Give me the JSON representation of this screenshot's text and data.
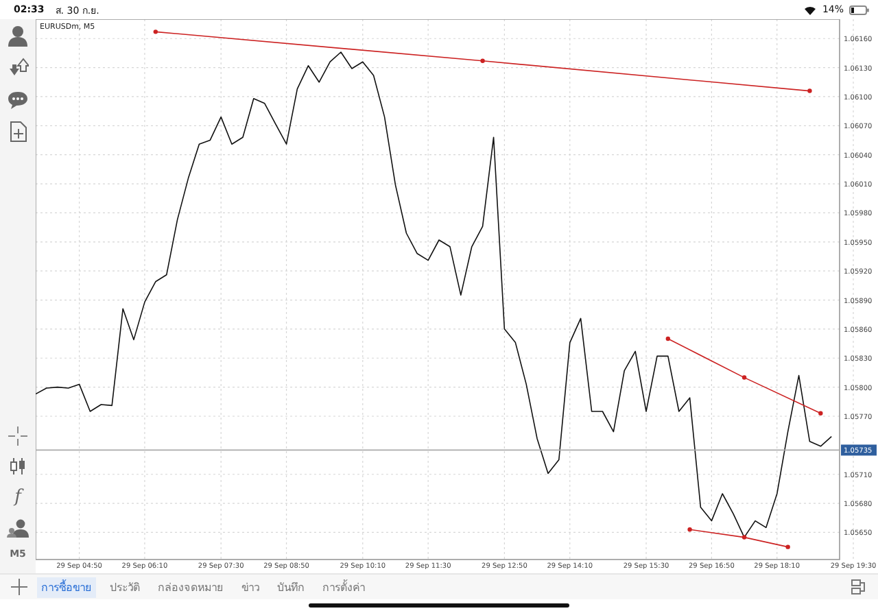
{
  "status_bar": {
    "time": "02:33",
    "date": "ส. 30 ก.ย.",
    "battery": "14%"
  },
  "toolbar": {
    "indicator": "f",
    "timeframe": "M5"
  },
  "chart": {
    "chart_data": {
      "type": "line",
      "title": "EURUSDm, M5",
      "categories": [
        null,
        null,
        null,
        null,
        "29 Sep 04:50",
        null,
        null,
        null,
        null,
        null,
        "29 Sep 06:10",
        null,
        null,
        null,
        null,
        null,
        null,
        "29 Sep 07:30",
        null,
        null,
        null,
        null,
        null,
        "29 Sep 08:50",
        null,
        null,
        null,
        null,
        null,
        null,
        "29 Sep 10:10",
        null,
        null,
        null,
        null,
        null,
        "29 Sep 11:30",
        null,
        null,
        null,
        null,
        null,
        null,
        "29 Sep 12:50",
        null,
        null,
        null,
        null,
        null,
        "29 Sep 14:10",
        null,
        null,
        null,
        null,
        null,
        null,
        "29 Sep 15:30",
        null,
        null,
        null,
        null,
        null,
        "29 Sep 16:50",
        null,
        null,
        null,
        null,
        null,
        "29 Sep 18:10",
        null,
        null,
        null,
        null,
        null,
        null,
        "29 Sep 19:30"
      ],
      "series": [
        {
          "color": "#111111",
          "values": [
            1.05793,
            1.05799,
            1.058,
            1.05799,
            1.05803,
            1.05775,
            1.05782,
            1.05781,
            1.05881,
            1.05849,
            1.05888,
            1.05909,
            1.05916,
            1.05973,
            1.06016,
            1.06051,
            1.06055,
            1.06079,
            1.06051,
            1.06058,
            1.06098,
            1.06093,
            1.06072,
            1.06051,
            1.06108,
            1.06132,
            1.06115,
            1.06136,
            1.06146,
            1.06129,
            1.06136,
            1.06122,
            1.06079,
            1.06009,
            1.05959,
            1.05938,
            1.05931,
            1.05952,
            1.05945,
            1.05895,
            1.05945,
            1.05966,
            1.06058,
            1.0586,
            1.05846,
            1.05803,
            1.05747,
            1.05711,
            1.05725,
            1.05846,
            1.05871,
            1.05775,
            1.05775,
            1.05754,
            1.05817,
            1.05837,
            1.05775,
            1.05832,
            1.05832,
            1.05775,
            1.05789,
            1.05676,
            1.05662,
            1.0569,
            1.05669,
            1.05645,
            1.05662,
            1.05655,
            1.0569,
            1.05754,
            1.05812,
            1.05744,
            1.05739,
            1.05749,
            null,
            null
          ]
        },
        {
          "color": "#cc2222",
          "marker": true,
          "values": [
            null,
            null,
            null,
            null,
            null,
            null,
            null,
            null,
            null,
            null,
            null,
            1.06167,
            null,
            null,
            null,
            null,
            null,
            null,
            null,
            null,
            null,
            null,
            null,
            null,
            null,
            null,
            null,
            null,
            null,
            null,
            null,
            null,
            null,
            null,
            null,
            null,
            null,
            null,
            null,
            null,
            null,
            1.06137,
            null,
            null,
            null,
            null,
            null,
            null,
            null,
            null,
            null,
            null,
            null,
            null,
            null,
            null,
            null,
            null,
            null,
            null,
            null,
            null,
            null,
            null,
            null,
            null,
            null,
            null,
            null,
            null,
            null,
            1.06106,
            null,
            null,
            null,
            null
          ]
        },
        {
          "color": "#cc2222",
          "marker": true,
          "values": [
            null,
            null,
            null,
            null,
            null,
            null,
            null,
            null,
            null,
            null,
            null,
            null,
            null,
            null,
            null,
            null,
            null,
            null,
            null,
            null,
            null,
            null,
            null,
            null,
            null,
            null,
            null,
            null,
            null,
            null,
            null,
            null,
            null,
            null,
            null,
            null,
            null,
            null,
            null,
            null,
            null,
            null,
            null,
            null,
            null,
            null,
            null,
            null,
            null,
            null,
            null,
            null,
            null,
            null,
            null,
            null,
            null,
            null,
            1.0585,
            null,
            null,
            null,
            null,
            null,
            null,
            1.0581,
            null,
            null,
            null,
            null,
            null,
            null,
            1.05773,
            null,
            null,
            null
          ]
        },
        {
          "color": "#cc2222",
          "marker": true,
          "values": [
            null,
            null,
            null,
            null,
            null,
            null,
            null,
            null,
            null,
            null,
            null,
            null,
            null,
            null,
            null,
            null,
            null,
            null,
            null,
            null,
            null,
            null,
            null,
            null,
            null,
            null,
            null,
            null,
            null,
            null,
            null,
            null,
            null,
            null,
            null,
            null,
            null,
            null,
            null,
            null,
            null,
            null,
            null,
            null,
            null,
            null,
            null,
            null,
            null,
            null,
            null,
            null,
            null,
            null,
            null,
            null,
            null,
            null,
            null,
            null,
            1.05653,
            null,
            null,
            null,
            null,
            1.05645,
            null,
            null,
            null,
            1.05635,
            null,
            null,
            null,
            null,
            null,
            null
          ]
        }
      ],
      "grid": true,
      "ylim": [
        1.05622,
        1.0618
      ],
      "yticks": [
        {
          "value": 1.0565,
          "label": "1.05650"
        },
        {
          "value": 1.0568,
          "label": "1.05680"
        },
        {
          "value": 1.0571,
          "label": "1.05710"
        },
        {
          "value": 1.0577,
          "label": "1.05770"
        },
        {
          "value": 1.058,
          "label": "1.05800"
        },
        {
          "value": 1.0583,
          "label": "1.05830"
        },
        {
          "value": 1.0586,
          "label": "1.05860"
        },
        {
          "value": 1.0589,
          "label": "1.05890"
        },
        {
          "value": 1.0592,
          "label": "1.05920"
        },
        {
          "value": 1.0595,
          "label": "1.05950"
        },
        {
          "value": 1.0598,
          "label": "1.05980"
        },
        {
          "value": 1.0601,
          "label": "1.06010"
        },
        {
          "value": 1.0604,
          "label": "1.06040"
        },
        {
          "value": 1.0607,
          "label": "1.06070"
        },
        {
          "value": 1.061,
          "label": "1.06100"
        },
        {
          "value": 1.0613,
          "label": "1.06130"
        },
        {
          "value": 1.0616,
          "label": "1.06160"
        }
      ],
      "ref_lines": [
        {
          "axis": "y",
          "value": 1.05735,
          "label": "1.05735",
          "color": "#aaaaaa"
        }
      ]
    }
  },
  "tabs": [
    {
      "label": "การซื้อขาย",
      "selected": true
    },
    {
      "label": "ประวัติ",
      "selected": false
    },
    {
      "label": "กล่องจดหมาย",
      "selected": false
    },
    {
      "label": "ข่าว",
      "selected": false
    },
    {
      "label": "บันทึก",
      "selected": false
    },
    {
      "label": "การตั้งค่า",
      "selected": false
    }
  ]
}
